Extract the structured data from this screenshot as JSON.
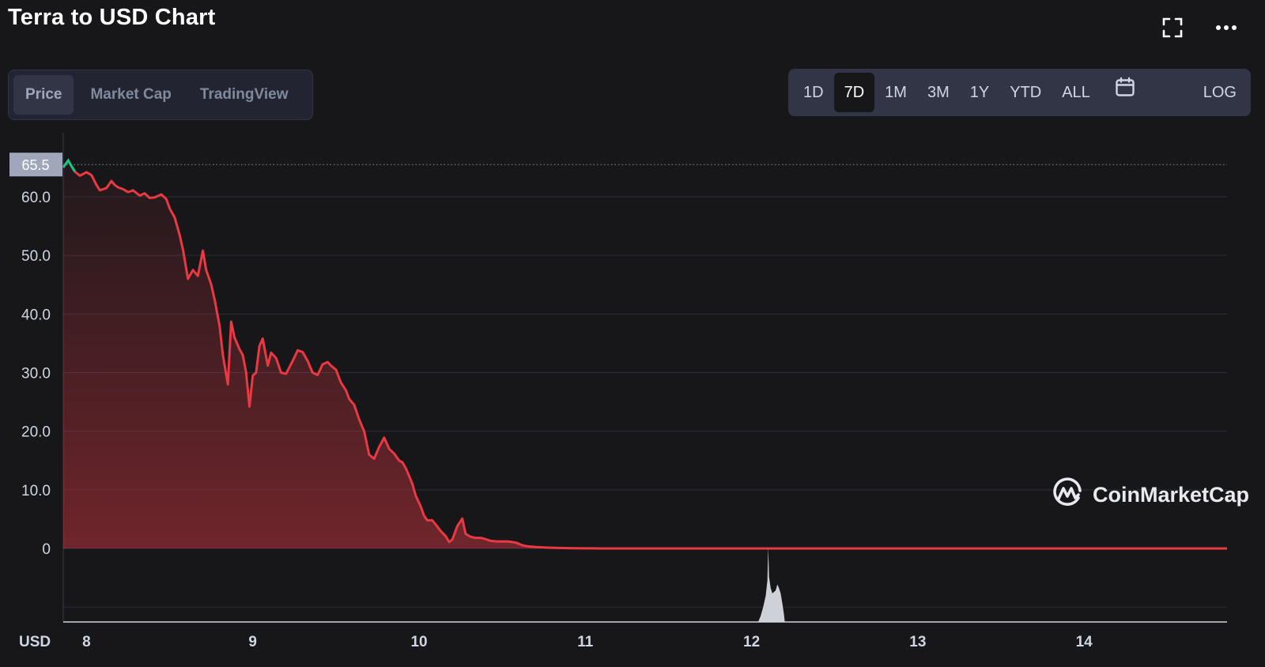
{
  "header": {
    "title": "Terra to USD Chart"
  },
  "icons": {
    "fullscreen": "fullscreen-icon",
    "more": "more-dots-icon",
    "calendar": "calendar-icon",
    "logo": "coinmarketcap-logo-icon"
  },
  "tabs": [
    {
      "label": "Price",
      "active": true
    },
    {
      "label": "Market Cap",
      "active": false
    },
    {
      "label": "TradingView",
      "active": false
    }
  ],
  "ranges": {
    "items": [
      {
        "label": "1D",
        "active": false
      },
      {
        "label": "7D",
        "active": true
      },
      {
        "label": "1M",
        "active": false
      },
      {
        "label": "3M",
        "active": false
      },
      {
        "label": "1Y",
        "active": false
      },
      {
        "label": "YTD",
        "active": false
      },
      {
        "label": "ALL",
        "active": false
      }
    ],
    "log_label": "LOG"
  },
  "watermark": {
    "text": "CoinMarketCap"
  },
  "colors": {
    "background": "#17171a",
    "line_down": "#ea3943",
    "line_up": "#16c784",
    "grid": "#2b2e3b",
    "axis_text": "#cfd6e4",
    "volume": "#d8dbe3",
    "price_tag_bg": "#a1a7bb"
  },
  "chart_data": {
    "type": "area",
    "title": "Terra to USD Chart",
    "currency_label": "USD",
    "current_price_label": "65.5",
    "y_ticks": [
      "0",
      "10.0",
      "20.0",
      "30.0",
      "40.0",
      "50.0",
      "60.0"
    ],
    "y_tick_values": [
      0,
      10,
      20,
      30,
      40,
      50,
      60
    ],
    "x_ticks": [
      "8",
      "9",
      "10",
      "11",
      "12",
      "13",
      "14"
    ],
    "x_tick_values": [
      8,
      9,
      10,
      11,
      12,
      13,
      14
    ],
    "xlim": [
      7.86,
      14.86
    ],
    "ylim": [
      -12.5,
      72
    ],
    "reference_line": 65.5,
    "grid": true,
    "series": [
      {
        "x": [
          7.86,
          7.89,
          7.91,
          7.93,
          7.96,
          8.0,
          8.03,
          8.06,
          8.08,
          8.12,
          8.15,
          8.17,
          8.19,
          8.22,
          8.25,
          8.28,
          8.32,
          8.35,
          8.38,
          8.41,
          8.45,
          8.48,
          8.5,
          8.53,
          8.56,
          8.58,
          8.61,
          8.64,
          8.67,
          8.7,
          8.72,
          8.75,
          8.77,
          8.8,
          8.82,
          8.85,
          8.87,
          8.89,
          8.92,
          8.94,
          8.96,
          8.98,
          9.0,
          9.02,
          9.04,
          9.06,
          9.09,
          9.11,
          9.14,
          9.17,
          9.2,
          9.24,
          9.27,
          9.3,
          9.33,
          9.36,
          9.39,
          9.42,
          9.45,
          9.47,
          9.5,
          9.53,
          9.56,
          9.58,
          9.61,
          9.64,
          9.67,
          9.7,
          9.73,
          9.76,
          9.79,
          9.82,
          9.85,
          9.88,
          9.9,
          9.92,
          9.94,
          9.96,
          9.98,
          10.01,
          10.03,
          10.05,
          10.08,
          10.1,
          10.13,
          10.16,
          10.18,
          10.2,
          10.23,
          10.26,
          10.28,
          10.31,
          10.34,
          10.37,
          10.4,
          10.43,
          10.47,
          10.5,
          10.53,
          10.56,
          10.58,
          10.6,
          10.62,
          10.65,
          10.7,
          10.75,
          10.8,
          10.85,
          10.9,
          10.95,
          11.0,
          11.05,
          11.1,
          11.2,
          11.3,
          11.5,
          11.7,
          12.0,
          12.5,
          13.0,
          13.5,
          14.0,
          14.5,
          14.86
        ],
        "y": [
          65.0,
          66.2,
          65.2,
          64.3,
          63.6,
          64.2,
          63.7,
          62.0,
          61.1,
          61.5,
          62.7,
          62.0,
          61.6,
          61.3,
          60.8,
          61.1,
          60.2,
          60.6,
          59.8,
          59.9,
          60.4,
          59.6,
          58.0,
          56.5,
          53.5,
          51.0,
          46.0,
          47.5,
          46.5,
          50.8,
          47.5,
          45.0,
          42.5,
          38.0,
          33.0,
          28.0,
          38.7,
          36.0,
          34.0,
          33.0,
          30.0,
          24.2,
          29.5,
          30.0,
          34.5,
          35.8,
          31.2,
          33.4,
          32.5,
          30.0,
          29.8,
          32.0,
          33.8,
          33.5,
          32.0,
          30.0,
          29.6,
          31.4,
          31.8,
          31.2,
          30.5,
          28.3,
          27.0,
          25.5,
          24.5,
          22.0,
          20.0,
          16.0,
          15.3,
          17.3,
          18.9,
          17.0,
          16.2,
          15.0,
          14.7,
          13.7,
          12.4,
          11.0,
          9.0,
          7.2,
          5.6,
          4.8,
          4.8,
          4.1,
          3.0,
          2.1,
          1.1,
          1.5,
          3.8,
          5.1,
          2.5,
          2.0,
          1.8,
          1.8,
          1.6,
          1.3,
          1.2,
          1.2,
          1.2,
          1.1,
          1.0,
          0.8,
          0.55,
          0.38,
          0.26,
          0.18,
          0.12,
          0.08,
          0.05,
          0.03,
          0.02,
          0.01,
          0.005,
          0.003,
          0.002,
          0.001,
          0.001,
          0.0007,
          0.0005,
          0.0004,
          0.0003,
          0.0002,
          0.0002,
          0.0001
        ],
        "start_up_until_x": 7.93
      }
    ],
    "volume": {
      "x": [
        12.04,
        12.055,
        12.07,
        12.085,
        12.095,
        12.1,
        12.105,
        12.115,
        12.125,
        12.135,
        12.145,
        12.155,
        12.165,
        12.175,
        12.185,
        12.195,
        12.2
      ],
      "relative": [
        0.0,
        0.08,
        0.2,
        0.35,
        0.55,
        1.0,
        0.6,
        0.45,
        0.38,
        0.4,
        0.42,
        0.5,
        0.45,
        0.38,
        0.25,
        0.1,
        0.0
      ]
    }
  }
}
